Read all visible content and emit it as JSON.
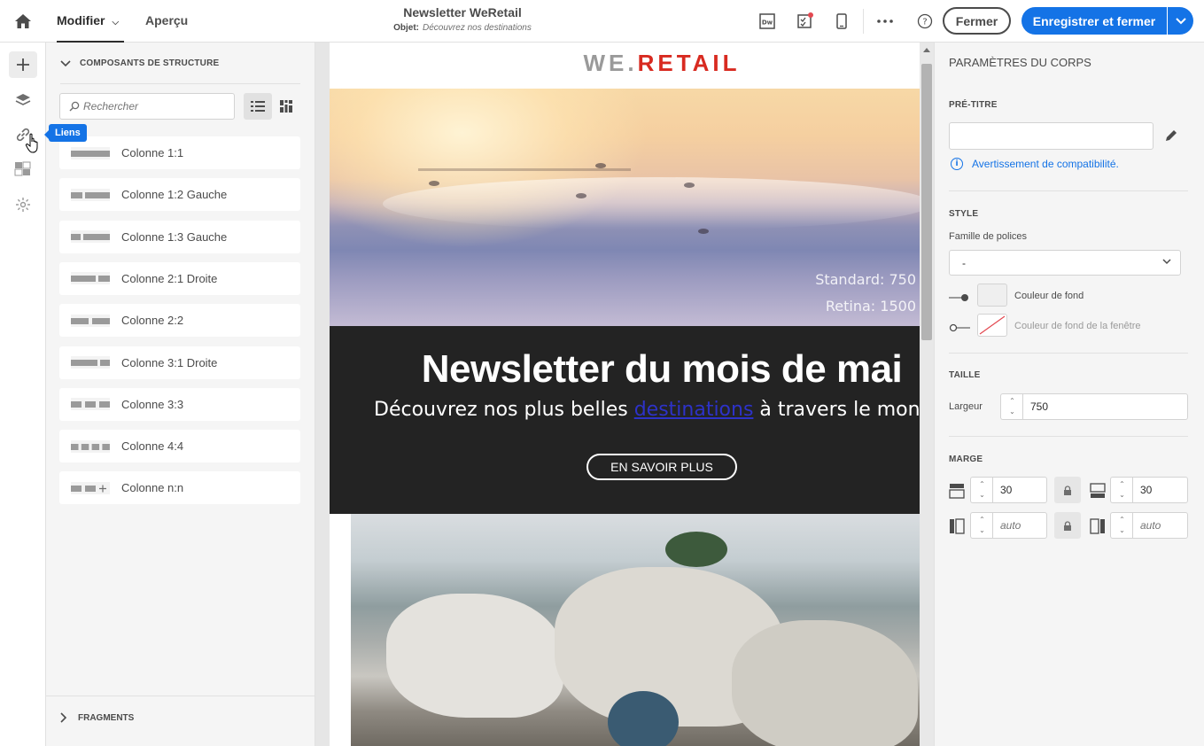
{
  "topbar": {
    "tab_edit": "Modifier",
    "tab_preview": "Aperçu",
    "doc_title": "Newsletter WeRetail",
    "subject_label": "Objet:",
    "subject_value": "Découvrez nos destinations",
    "close_label": "Fermer",
    "save_label": "Enregistrer et fermer",
    "icons": [
      "home-icon",
      "dreamweaver-icon",
      "checklist-icon",
      "mobile-preview-icon",
      "more-icon",
      "help-icon"
    ]
  },
  "rail": {
    "tooltip": "Liens",
    "icons": [
      "add-icon",
      "layers-icon",
      "link-icon",
      "image-gallery-icon",
      "personalization-icon"
    ]
  },
  "components": {
    "header": "COMPOSANTS DE STRUCTURE",
    "search_placeholder": "Rechercher",
    "items": [
      {
        "label": "Colonne 1:1",
        "icon": "column-1-1"
      },
      {
        "label": "Colonne 1:2 Gauche",
        "icon": "column-1-2-left"
      },
      {
        "label": "Colonne 1:3 Gauche",
        "icon": "column-1-3-left"
      },
      {
        "label": "Colonne 2:1 Droite",
        "icon": "column-2-1-right"
      },
      {
        "label": "Colonne 2:2",
        "icon": "column-2-2"
      },
      {
        "label": "Colonne 3:1 Droite",
        "icon": "column-3-1-right"
      },
      {
        "label": "Colonne 3:3",
        "icon": "column-3-3"
      },
      {
        "label": "Colonne 4:4",
        "icon": "column-4-4"
      },
      {
        "label": "Colonne n:n",
        "icon": "column-n-n"
      }
    ],
    "fragments": "FRAGMENTS"
  },
  "email": {
    "logo_left": "WE.",
    "logo_right": "RETAIL",
    "hero_standard": "Standard: 750",
    "hero_retina": "Retina: 1500",
    "headline": "Newsletter du mois de mai",
    "sub_before": "Découvrez nos plus belles ",
    "sub_link": "destinations",
    "sub_after": " à travers le monde",
    "cta": "EN SAVOIR PLUS"
  },
  "props": {
    "title": "PARAMÈTRES DU CORPS",
    "pretitle": {
      "label": "PRÉ-TITRE",
      "value": "",
      "warning": "Avertissement de compatibilité."
    },
    "style": {
      "label": "STYLE",
      "font_family_label": "Famille de polices",
      "font_family_value": "-",
      "bg_color_label": "Couleur de fond",
      "window_bg_color_label": "Couleur de fond de la fenêtre"
    },
    "size": {
      "label": "TAILLE",
      "width_label": "Largeur",
      "width_value": "750"
    },
    "margin": {
      "label": "MARGE",
      "top": "30",
      "bottom": "30",
      "left_placeholder": "auto",
      "right_placeholder": "auto"
    }
  },
  "colors": {
    "accent": "#1473e6",
    "brand_red": "#d82a20",
    "dark_band": "#232323"
  }
}
